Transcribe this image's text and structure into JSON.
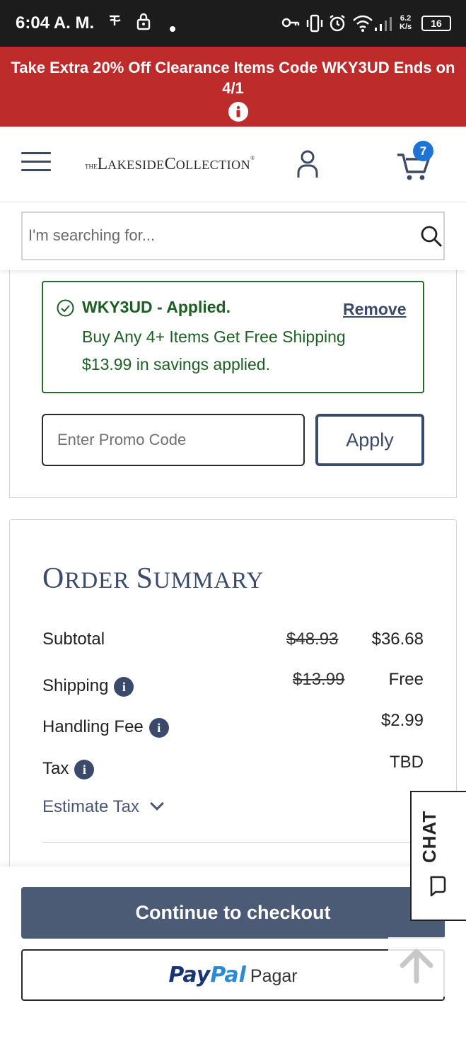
{
  "status_bar": {
    "time": "6:04 A. M.",
    "net_speed_value": "6.2",
    "net_speed_unit": "K/s",
    "battery": "16"
  },
  "promo_banner": {
    "text": "Take Extra 20% Off Clearance Items Code WKY3UD Ends on 4/1",
    "info_icon": "info-icon"
  },
  "header": {
    "logo": {
      "the": "THE",
      "word1_cap": "L",
      "word1_rest": "AKESIDE",
      "word2_cap": "C",
      "word2_rest": "OLLECTION",
      "reg": "®"
    },
    "cart_count": "7",
    "icons": [
      "menu-icon",
      "account-icon",
      "cart-icon"
    ]
  },
  "search": {
    "placeholder": "I'm searching for...",
    "value": ""
  },
  "promo_code": {
    "applied_title": "WKY3UD - Applied.",
    "remove_label": "Remove",
    "line1": "Buy Any 4+ Items Get Free Shipping",
    "line2": "$13.99 in savings applied.",
    "input_placeholder": "Enter Promo Code",
    "apply_label": "Apply"
  },
  "order_summary": {
    "title_cap1": "O",
    "title_rest1": "RDER ",
    "title_cap2": "S",
    "title_rest2": "UMMARY",
    "rows": [
      {
        "label": "Subtotal",
        "original": "$48.93",
        "value": "$36.68"
      },
      {
        "label": "Shipping",
        "original": "$13.99",
        "value": "Free"
      },
      {
        "label": "Handling Fee",
        "original": "",
        "value": "$2.99"
      },
      {
        "label": "Tax",
        "original": "",
        "value": "TBD"
      }
    ],
    "estimate_tax_label": "Estimate Tax"
  },
  "actions": {
    "checkout_label": "Continue to checkout",
    "paypal_pay": "Pay",
    "paypal_pal": "Pal",
    "paypal_pagar": "Pagar"
  },
  "chat": {
    "label": "CHAT"
  },
  "colors": {
    "promo_red": "#be2b2b",
    "navy": "#3a4a6b",
    "success_green": "#1c5f23",
    "checkout_bg": "#4b5a75",
    "badge_blue": "#1e73d6"
  }
}
